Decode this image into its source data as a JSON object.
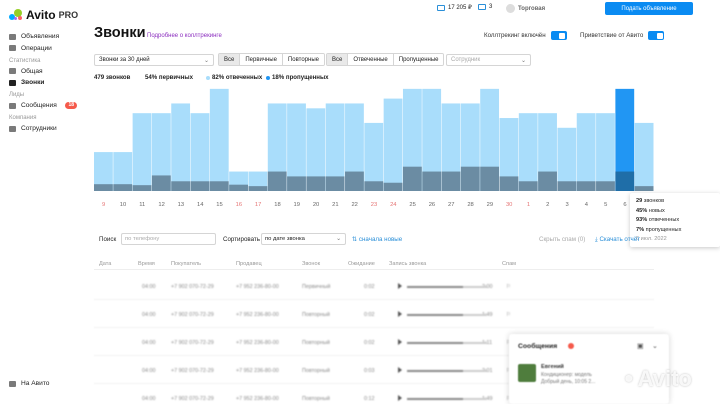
{
  "sidebar": {
    "logo_text": "Avito",
    "logo_pro": "PRO",
    "items": [
      {
        "label": "Объявления",
        "type": "item"
      },
      {
        "label": "Операции",
        "type": "item"
      },
      {
        "label": "Статистика",
        "type": "section"
      },
      {
        "label": "Общая",
        "type": "item"
      },
      {
        "label": "Звонки",
        "type": "item",
        "active": true
      },
      {
        "label": "Лиды",
        "type": "section"
      },
      {
        "label": "Сообщения",
        "type": "item",
        "badge": "18"
      },
      {
        "label": "Компания",
        "type": "section"
      },
      {
        "label": "Сотрудники",
        "type": "item"
      }
    ],
    "on_avito": "На Авито"
  },
  "topbar": {
    "balance": "17 205 ₽",
    "notifications": "3",
    "company": "Торговая",
    "post_button": "Подать объявление"
  },
  "header": {
    "title": "Звонки",
    "link": "Подробнее о коллтрекинге",
    "toggle_tracking": "Коллтрекинг включён",
    "toggle_greeting": "Приветствие от Авито"
  },
  "filters": {
    "period": "Звонки за 30 дней",
    "type_options": [
      "Все",
      "Первичные",
      "Повторные"
    ],
    "status_options": [
      "Все",
      "Отвеченные",
      "Пропущенные"
    ],
    "employee_placeholder": "Сотрудник"
  },
  "stats": {
    "total": "479 звонков",
    "primary": "54% первичных",
    "answered": "82% отвеченных",
    "missed": "18% пропущенных"
  },
  "colors": {
    "answered": "#a9ddfb",
    "missed": "#5ba8e3",
    "primary": "#6b8ca3",
    "highlight": "#2196f3",
    "highlight_primary": "#1f6ea8",
    "accent": "#0a8bf2"
  },
  "chart_data": {
    "type": "bar",
    "categories": [
      "9",
      "10",
      "11",
      "12",
      "13",
      "14",
      "15",
      "16",
      "17",
      "18",
      "19",
      "20",
      "21",
      "22",
      "23",
      "24",
      "25",
      "26",
      "27",
      "28",
      "29",
      "30",
      "1",
      "2",
      "3",
      "4",
      "5",
      "6",
      "7"
    ],
    "weekend_categories": [
      "9",
      "16",
      "17",
      "23",
      "24",
      "30",
      "1",
      "7"
    ],
    "series": [
      {
        "name": "Звонки",
        "values": [
          8,
          8,
          16,
          16,
          18,
          16,
          21,
          4,
          4,
          18,
          18,
          17,
          18,
          18,
          14,
          19,
          21,
          21,
          18,
          18,
          21,
          15,
          16,
          16,
          13,
          16,
          16,
          21,
          14
        ]
      },
      {
        "name": "Первичные",
        "values": [
          1.4,
          1.4,
          1.2,
          3.2,
          2,
          2,
          2,
          1.3,
          1,
          4,
          3,
          3,
          3,
          4,
          2,
          1.7,
          5,
          4,
          4,
          5,
          5,
          3,
          2,
          4,
          2,
          2,
          2,
          4,
          1
        ]
      }
    ],
    "highlight_index": 27,
    "ylim": [
      0,
      22
    ]
  },
  "tooltip": {
    "calls": "29",
    "calls_label": "звонков",
    "new": "45%",
    "new_label": "новых",
    "answered": "93%",
    "answered_label": "отвеченных",
    "missed": "7%",
    "missed_label": "пропущенных",
    "date": "6 июл. 2022"
  },
  "table": {
    "search_label": "Поиск",
    "search_placeholder": "по телефону",
    "sort_label": "Сортировать",
    "sort_value": "по дате звонка",
    "sort_order": "сначала новые",
    "hide_spam": "Скрыть спам (0)",
    "download": "Скачать отчёт",
    "columns": [
      "Дата",
      "Время",
      "Покупатель",
      "Продавец",
      "Звонок",
      "Ожидание",
      "Запись звонка",
      "Спам"
    ],
    "rows": [
      {
        "time": "04:00",
        "buyer": "+7 902 070-72-29",
        "seller": "+7 952 236-80-00",
        "call": "Первичный",
        "wait": "0:02",
        "dur": "2:00"
      },
      {
        "time": "04:00",
        "buyer": "+7 902 070-72-29",
        "seller": "+7 952 236-80-00",
        "call": "Повторный",
        "wait": "0:02",
        "dur": "1:49"
      },
      {
        "time": "04:00",
        "buyer": "+7 902 070-72-29",
        "seller": "+7 952 236-80-00",
        "call": "Повторный",
        "wait": "0:02",
        "dur": "1:11"
      },
      {
        "time": "04:00",
        "buyer": "+7 902 070-72-29",
        "seller": "+7 952 236-80-00",
        "call": "Повторный",
        "wait": "0:03",
        "dur": "2:01"
      },
      {
        "time": "04:00",
        "buyer": "+7 902 070-72-29",
        "seller": "+7 952 236-80-00",
        "call": "Повторный",
        "wait": "0:12",
        "dur": "1:49"
      }
    ]
  },
  "messages": {
    "title": "Сообщения",
    "sender": "Евгений",
    "preview": "Кондиционер: модель",
    "preview2": "Добрый день, 10:05 2..."
  },
  "watermark": "Avito"
}
